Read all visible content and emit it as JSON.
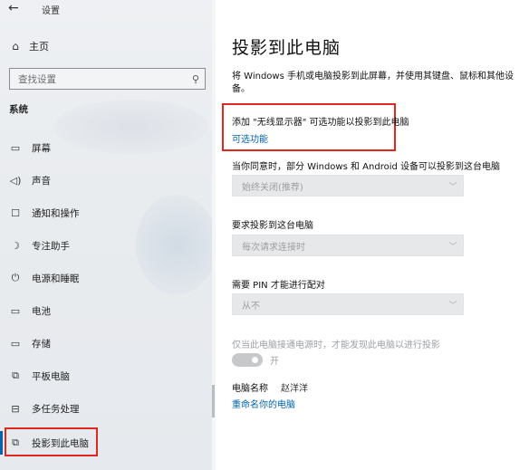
{
  "app": {
    "title": "设置"
  },
  "sidebar": {
    "home": "主页",
    "search_placeholder": "查找设置",
    "section": "系统",
    "items": [
      {
        "label": "屏幕",
        "icon": "monitor-icon"
      },
      {
        "label": "声音",
        "icon": "speaker-icon"
      },
      {
        "label": "通知和操作",
        "icon": "notification-icon"
      },
      {
        "label": "专注助手",
        "icon": "moon-icon"
      },
      {
        "label": "电源和睡眠",
        "icon": "power-icon"
      },
      {
        "label": "电池",
        "icon": "battery-icon"
      },
      {
        "label": "存储",
        "icon": "storage-icon"
      },
      {
        "label": "平板电脑",
        "icon": "tablet-icon"
      },
      {
        "label": "多任务处理",
        "icon": "multitask-icon"
      },
      {
        "label": "投影到此电脑",
        "icon": "projection-icon"
      }
    ],
    "active_index": 9
  },
  "main": {
    "title": "投影到此电脑",
    "description": "将 Windows 手机或电脑投影到此屏幕，并使用其键盘、鼠标和其他设备。",
    "optional_feature_text": "添加 \"无线显示器\" 可选功能以投影到此电脑",
    "optional_feature_link": "可选功能",
    "allow_label": "当你同意时，部分 Windows 和 Android 设备可以投影到这台电脑",
    "allow_value": "始终关闭(推荐)",
    "ask_label": "要求投影到这台电脑",
    "ask_value": "每次请求连接时",
    "pin_label": "需要 PIN 才能进行配对",
    "pin_value": "从不",
    "power_label": "仅当此电脑接通电源时，才能发现此电脑以进行投影",
    "power_toggle_label": "开",
    "pc_name_label": "电脑名称",
    "pc_name_value": "赵洋洋",
    "rename_link": "重命名你的电脑"
  },
  "colors": {
    "accent": "#0063b1",
    "highlight_box": "#e0281e"
  }
}
